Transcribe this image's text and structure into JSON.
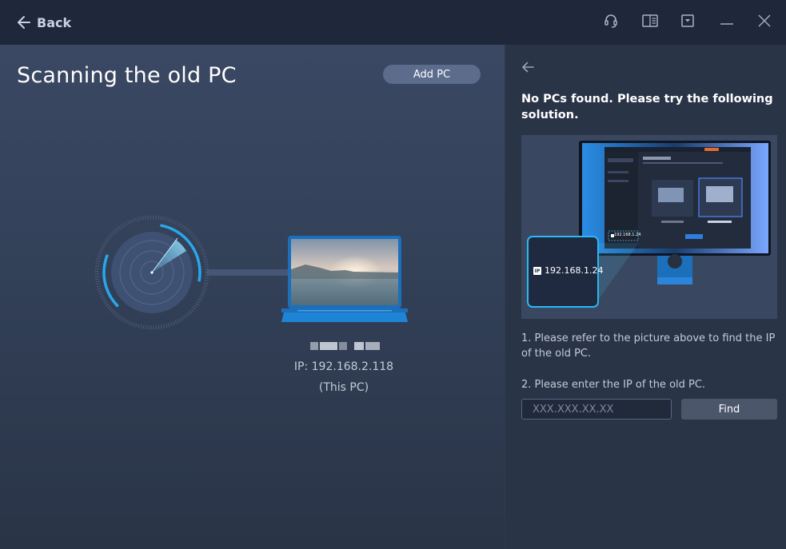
{
  "titlebar": {
    "back_label": "Back",
    "icons": [
      "headset-icon",
      "manual-icon",
      "dropdown-menu-icon",
      "minimize-icon",
      "close-icon"
    ]
  },
  "left": {
    "title": "Scanning the old PC",
    "add_pc_label": "Add PC",
    "device": {
      "ip_text": "IP: 192.168.2.118",
      "sub_text": "(This PC)"
    }
  },
  "right": {
    "heading": "No PCs found. Please try the following solution.",
    "illustration": {
      "ip_badge": "IP",
      "ip_value": "192.168.1.24",
      "small_ip_value": "192.168.1.24"
    },
    "step1": "1. Please refer to the picture above to find the IP of the old PC.",
    "step2": "2. Please enter the IP of the old PC.",
    "ip_input": {
      "placeholder": "XXX.XXX.XX.XX",
      "value": ""
    },
    "find_label": "Find"
  },
  "colors": {
    "accent": "#29a7e9",
    "titlebar_bg": "#1f283a",
    "panel_bg": "#2a3447",
    "button_bg": "#5b6c8c"
  }
}
